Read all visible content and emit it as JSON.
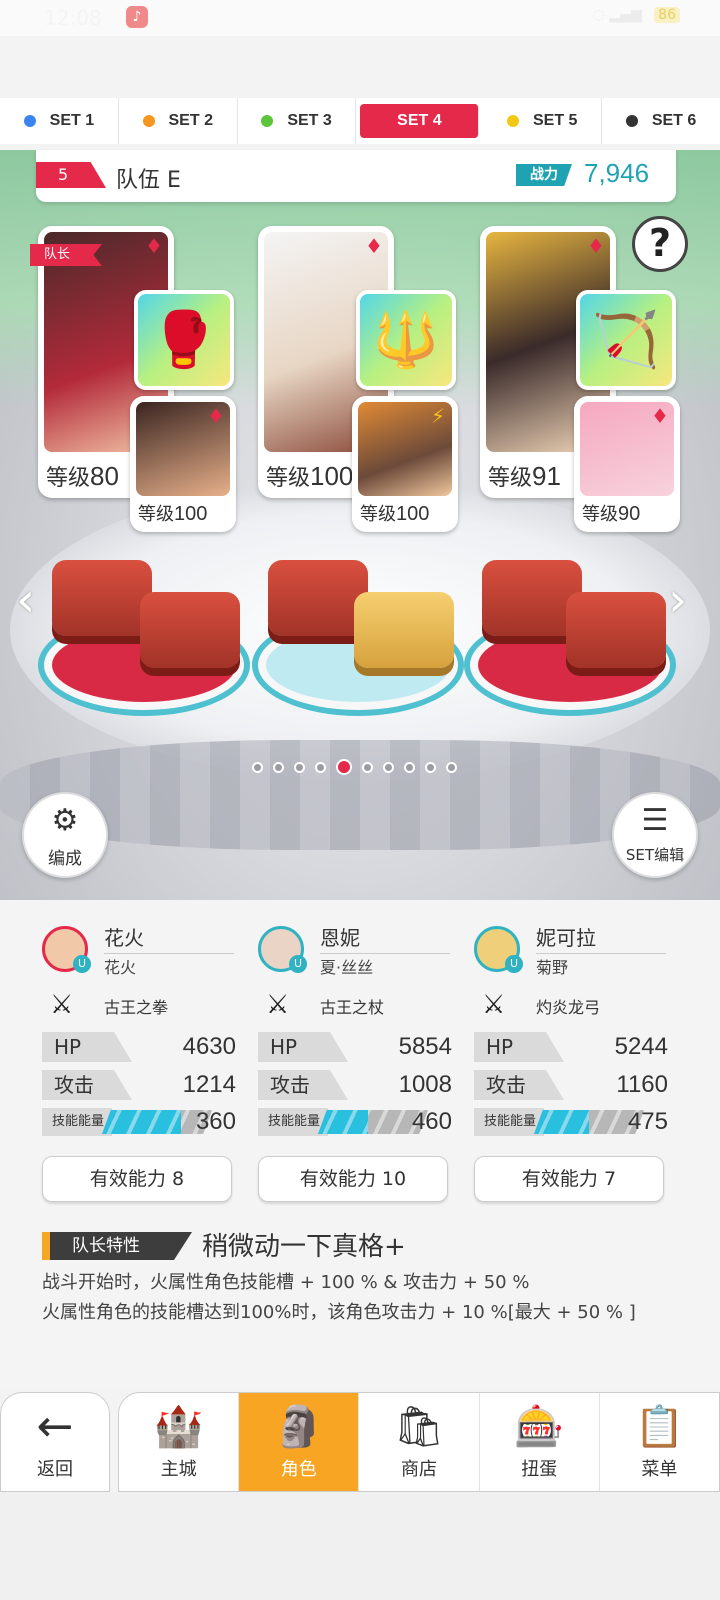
{
  "status": {
    "time": "12:08",
    "battery": "86"
  },
  "tabs": [
    {
      "label": "SET 1",
      "color": "#3a84f0"
    },
    {
      "label": "SET 2",
      "color": "#f5961e"
    },
    {
      "label": "SET 3",
      "color": "#5cc53a"
    },
    {
      "label": "SET 4",
      "color": "#e5294a",
      "active": true
    },
    {
      "label": "SET 5",
      "color": "#f3c814"
    },
    {
      "label": "SET 6",
      "color": "#333333"
    }
  ],
  "team": {
    "number": "5",
    "name": "队伍 E",
    "power_label": "战力",
    "power_value": "7,946"
  },
  "help": "?",
  "leader_badge": "队长",
  "cards": {
    "main": [
      {
        "level_label": "等级",
        "level": "80"
      },
      {
        "level_label": "等级",
        "level": "100"
      },
      {
        "level_label": "等级",
        "level": "91"
      }
    ],
    "sub": [
      {
        "level_label": "等级",
        "level": "100"
      },
      {
        "level_label": "等级",
        "level": "100"
      },
      {
        "level_label": "等级",
        "level": "90"
      }
    ]
  },
  "pager": {
    "count": 10,
    "active": 4
  },
  "buttons": {
    "formation": "编成",
    "set_edit": "SET编辑"
  },
  "characters": [
    {
      "name": "花火",
      "sub": "花火",
      "weapon": "古王之拳",
      "hp_label": "HP",
      "hp": "4630",
      "atk_label": "攻击",
      "atk": "1214",
      "energy_label": "技能能量",
      "energy": "360",
      "energy_pct": 0.72,
      "ability": "有效能力 8"
    },
    {
      "name": "恩妮",
      "sub": "夏·丝丝",
      "weapon": "古王之杖",
      "hp_label": "HP",
      "hp": "5854",
      "atk_label": "攻击",
      "atk": "1008",
      "energy_label": "技能能量",
      "energy": "460",
      "energy_pct": 0.45,
      "ability": "有效能力 10"
    },
    {
      "name": "妮可拉",
      "sub": "菊野",
      "weapon": "灼炎龙弓",
      "hp_label": "HP",
      "hp": "5244",
      "atk_label": "攻击",
      "atk": "1160",
      "energy_label": "技能能量",
      "energy": "475",
      "energy_pct": 0.5,
      "ability": "有效能力 7"
    }
  ],
  "trait": {
    "label": "队长特性",
    "name": "稍微动一下真格+",
    "line1": "战斗开始时，火属性角色技能槽 + 100 % & 攻击力 + 50 %",
    "line2": "火属性角色的技能槽达到100%时，该角色攻击力 + 10 %[最大 + 50 % ]"
  },
  "nav": {
    "back": "返回",
    "items": [
      {
        "label": "主城",
        "icon": "castle-icon"
      },
      {
        "label": "角色",
        "icon": "character-icon",
        "active": true
      },
      {
        "label": "商店",
        "icon": "shop-icon"
      },
      {
        "label": "扭蛋",
        "icon": "gacha-icon"
      },
      {
        "label": "菜单",
        "icon": "menu-icon"
      }
    ]
  }
}
